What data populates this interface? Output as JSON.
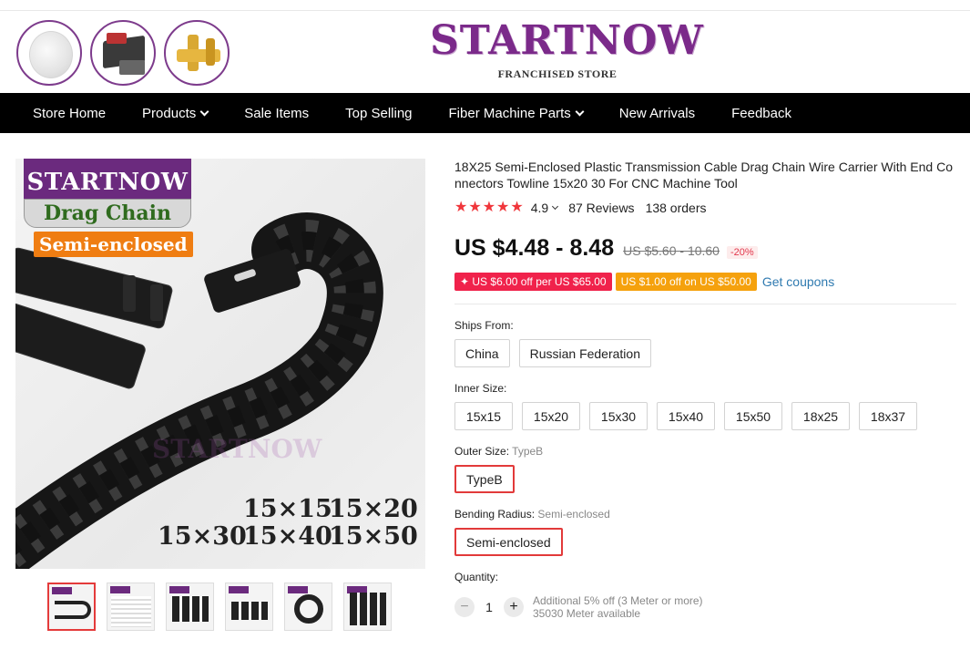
{
  "header": {
    "brand_name": "STARTNOW",
    "brand_sub": "FRANCHISED STORE",
    "brand_color": "#7b2a8a",
    "thumb_icons": [
      "lens-thumb",
      "laser-source-thumb",
      "brass-holder-thumb"
    ]
  },
  "nav": {
    "items": [
      {
        "label": "Store Home",
        "dropdown": false
      },
      {
        "label": "Products",
        "dropdown": true
      },
      {
        "label": "Sale Items",
        "dropdown": false
      },
      {
        "label": "Top Selling",
        "dropdown": false
      },
      {
        "label": "Fiber Machine Parts",
        "dropdown": true
      },
      {
        "label": "New Arrivals",
        "dropdown": false
      },
      {
        "label": "Feedback",
        "dropdown": false
      }
    ]
  },
  "main_image": {
    "brand": "STARTNOW",
    "banner": "Drag Chain",
    "tag": "Semi-enclosed",
    "watermark": "STARTNOW",
    "sizes_row1": [
      "15×15",
      "15×20"
    ],
    "sizes_row2": [
      "15×30",
      "15×40",
      "15×50"
    ]
  },
  "thumbnails": {
    "selected_index": 0,
    "count": 6
  },
  "product": {
    "title": "18X25 Semi-Enclosed Plastic Transmission Cable Drag Chain Wire Carrier With End Connectors Towline 15x20 30 For CNC Machine Tool",
    "rating": "4.9",
    "stars": 5,
    "reviews": "87 Reviews",
    "orders": "138 orders",
    "price": "US $4.48 - 8.48",
    "old_price": "US $5.60 - 10.60",
    "discount": "-20%",
    "coupon_a": "✦ US $6.00 off per US $65.00",
    "coupon_b": "US $1.00 off on US $50.00",
    "get_coupons": "Get coupons"
  },
  "options": {
    "ships_from": {
      "label": "Ships From:",
      "values": [
        "China",
        "Russian Federation"
      ]
    },
    "inner_size": {
      "label": "Inner Size:",
      "values": [
        "15x15",
        "15x20",
        "15x30",
        "15x40",
        "15x50",
        "18x25",
        "18x37"
      ]
    },
    "outer_size": {
      "label": "Outer Size:",
      "selected_text": "TypeB",
      "values": [
        "TypeB"
      ]
    },
    "bending_radius": {
      "label": "Bending Radius:",
      "selected_text": "Semi-enclosed",
      "values": [
        "Semi-enclosed"
      ]
    }
  },
  "quantity": {
    "label": "Quantity:",
    "minus": "−",
    "plus": "+",
    "value": "1",
    "note1": "Additional 5% off (3 Meter or more)",
    "note2": "35030 Meter available"
  },
  "colors": {
    "accent_red": "#e23a3a",
    "star_red": "#f0363b",
    "coupon_pink": "#f0224b",
    "coupon_orange": "#f5a10d",
    "link_blue": "#2f7ab0",
    "nav_bg": "#000000"
  }
}
